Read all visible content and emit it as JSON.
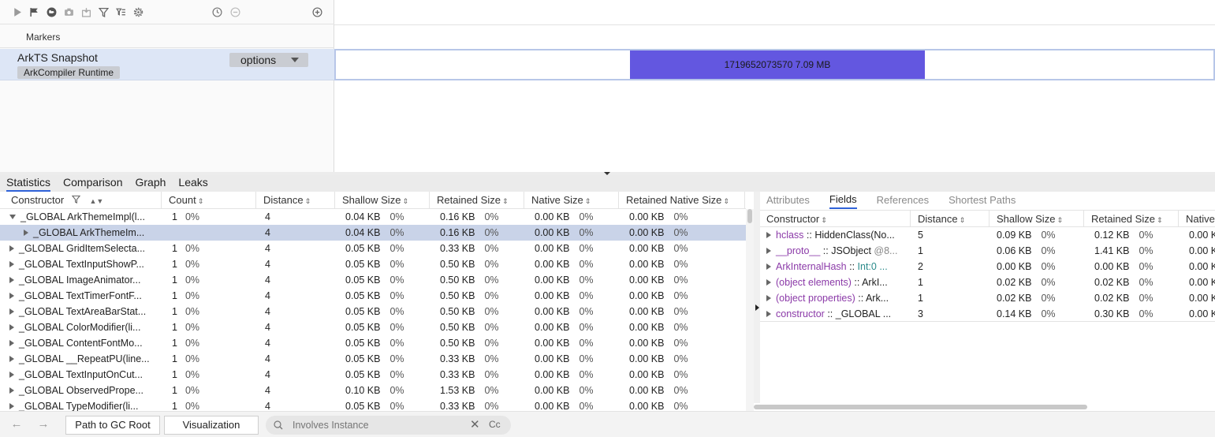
{
  "toolbar": {
    "icons": [
      "play-icon",
      "flag-icon",
      "globe-icon",
      "camera-icon",
      "dump-icon",
      "filter-icon",
      "filter-flow-icon",
      "gear-icon"
    ],
    "right_icons": [
      "clock-icon",
      "minus-circle-icon",
      "plus-circle-icon"
    ]
  },
  "timeline": {
    "markers_label": "Markers",
    "snapshot_title": "ArkTS Snapshot",
    "snapshot_subtitle": "ArkCompiler Runtime",
    "options_label": "options",
    "bar_label": "1719652073570 7.09 MB",
    "bar_color": "#6357e0"
  },
  "tabs": [
    {
      "label": "Statistics",
      "active": true
    },
    {
      "label": "Comparison",
      "active": false
    },
    {
      "label": "Graph",
      "active": false
    },
    {
      "label": "Leaks",
      "active": false
    }
  ],
  "left_table": {
    "columns": [
      "Constructor",
      "Count",
      "Distance",
      "Shallow Size",
      "Retained Size",
      "Native Size",
      "Retained Native Size"
    ],
    "rows": [
      {
        "name": "_GLOBAL ArkThemeImpl(l...",
        "count": "1",
        "count_pct": "0%",
        "distance": "4",
        "shallow": "0.04 KB",
        "shallow_pct": "0%",
        "retained": "0.16 KB",
        "retained_pct": "0%",
        "native": "0.00 KB",
        "native_pct": "0%",
        "rnative": "0.00 KB",
        "rnative_pct": "0%"
      },
      {
        "name": "_GLOBAL ArkThemeIm...",
        "count": "",
        "count_pct": "",
        "distance": "4",
        "shallow": "0.04 KB",
        "shallow_pct": "0%",
        "retained": "0.16 KB",
        "retained_pct": "0%",
        "native": "0.00 KB",
        "native_pct": "0%",
        "rnative": "0.00 KB",
        "rnative_pct": "0%"
      },
      {
        "name": "_GLOBAL GridItemSelecta...",
        "count": "1",
        "count_pct": "0%",
        "distance": "4",
        "shallow": "0.05 KB",
        "shallow_pct": "0%",
        "retained": "0.33 KB",
        "retained_pct": "0%",
        "native": "0.00 KB",
        "native_pct": "0%",
        "rnative": "0.00 KB",
        "rnative_pct": "0%"
      },
      {
        "name": "_GLOBAL TextInputShowP...",
        "count": "1",
        "count_pct": "0%",
        "distance": "4",
        "shallow": "0.05 KB",
        "shallow_pct": "0%",
        "retained": "0.50 KB",
        "retained_pct": "0%",
        "native": "0.00 KB",
        "native_pct": "0%",
        "rnative": "0.00 KB",
        "rnative_pct": "0%"
      },
      {
        "name": "_GLOBAL ImageAnimator...",
        "count": "1",
        "count_pct": "0%",
        "distance": "4",
        "shallow": "0.05 KB",
        "shallow_pct": "0%",
        "retained": "0.50 KB",
        "retained_pct": "0%",
        "native": "0.00 KB",
        "native_pct": "0%",
        "rnative": "0.00 KB",
        "rnative_pct": "0%"
      },
      {
        "name": "_GLOBAL TextTimerFontF...",
        "count": "1",
        "count_pct": "0%",
        "distance": "4",
        "shallow": "0.05 KB",
        "shallow_pct": "0%",
        "retained": "0.50 KB",
        "retained_pct": "0%",
        "native": "0.00 KB",
        "native_pct": "0%",
        "rnative": "0.00 KB",
        "rnative_pct": "0%"
      },
      {
        "name": "_GLOBAL TextAreaBarStat...",
        "count": "1",
        "count_pct": "0%",
        "distance": "4",
        "shallow": "0.05 KB",
        "shallow_pct": "0%",
        "retained": "0.50 KB",
        "retained_pct": "0%",
        "native": "0.00 KB",
        "native_pct": "0%",
        "rnative": "0.00 KB",
        "rnative_pct": "0%"
      },
      {
        "name": "_GLOBAL ColorModifier(li...",
        "count": "1",
        "count_pct": "0%",
        "distance": "4",
        "shallow": "0.05 KB",
        "shallow_pct": "0%",
        "retained": "0.50 KB",
        "retained_pct": "0%",
        "native": "0.00 KB",
        "native_pct": "0%",
        "rnative": "0.00 KB",
        "rnative_pct": "0%"
      },
      {
        "name": "_GLOBAL ContentFontMo...",
        "count": "1",
        "count_pct": "0%",
        "distance": "4",
        "shallow": "0.05 KB",
        "shallow_pct": "0%",
        "retained": "0.50 KB",
        "retained_pct": "0%",
        "native": "0.00 KB",
        "native_pct": "0%",
        "rnative": "0.00 KB",
        "rnative_pct": "0%"
      },
      {
        "name": "_GLOBAL __RepeatPU(line...",
        "count": "1",
        "count_pct": "0%",
        "distance": "4",
        "shallow": "0.05 KB",
        "shallow_pct": "0%",
        "retained": "0.33 KB",
        "retained_pct": "0%",
        "native": "0.00 KB",
        "native_pct": "0%",
        "rnative": "0.00 KB",
        "rnative_pct": "0%"
      },
      {
        "name": "_GLOBAL TextInputOnCut...",
        "count": "1",
        "count_pct": "0%",
        "distance": "4",
        "shallow": "0.05 KB",
        "shallow_pct": "0%",
        "retained": "0.33 KB",
        "retained_pct": "0%",
        "native": "0.00 KB",
        "native_pct": "0%",
        "rnative": "0.00 KB",
        "rnative_pct": "0%"
      },
      {
        "name": "_GLOBAL ObservedPrope...",
        "count": "1",
        "count_pct": "0%",
        "distance": "4",
        "shallow": "0.10 KB",
        "shallow_pct": "0%",
        "retained": "1.53 KB",
        "retained_pct": "0%",
        "native": "0.00 KB",
        "native_pct": "0%",
        "rnative": "0.00 KB",
        "rnative_pct": "0%"
      },
      {
        "name": "_GLOBAL TypeModifier(li...",
        "count": "1",
        "count_pct": "0%",
        "distance": "4",
        "shallow": "0.05 KB",
        "shallow_pct": "0%",
        "retained": "0.33 KB",
        "retained_pct": "0%",
        "native": "0.00 KB",
        "native_pct": "0%",
        "rnative": "0.00 KB",
        "rnative_pct": "0%"
      }
    ]
  },
  "right_panel": {
    "tabs": [
      {
        "label": "Attributes",
        "active": false
      },
      {
        "label": "Fields",
        "active": true
      },
      {
        "label": "References",
        "active": false
      },
      {
        "label": "Shortest Paths",
        "active": false
      }
    ],
    "columns": [
      "Constructor",
      "Distance",
      "Shallow Size",
      "Retained Size",
      "Native"
    ],
    "rows": [
      {
        "field": "hclass",
        "sep": " :: ",
        "value": "HiddenClass(No...",
        "extra": "",
        "distance": "5",
        "shallow": "0.09 KB",
        "shallow_pct": "0%",
        "retained": "0.12 KB",
        "retained_pct": "0%",
        "native": "0.00 K"
      },
      {
        "field": "__proto__",
        "sep": " :: ",
        "value": "JSObject ",
        "extra": "@8...",
        "distance": "1",
        "shallow": "0.06 KB",
        "shallow_pct": "0%",
        "retained": "1.41 KB",
        "retained_pct": "0%",
        "native": "0.00 K"
      },
      {
        "field": "ArkInternalHash",
        "sep": " :: ",
        "value": "",
        "extra": "Int:0 ...",
        "distance": "2",
        "shallow": "0.00 KB",
        "shallow_pct": "0%",
        "retained": "0.00 KB",
        "retained_pct": "0%",
        "native": "0.00 K"
      },
      {
        "field": "(object elements)",
        "sep": " :: ",
        "value": "ArkI...",
        "extra": "",
        "distance": "1",
        "shallow": "0.02 KB",
        "shallow_pct": "0%",
        "retained": "0.02 KB",
        "retained_pct": "0%",
        "native": "0.00 K"
      },
      {
        "field": "(object properties)",
        "sep": " :: ",
        "value": "Ark...",
        "extra": "",
        "distance": "1",
        "shallow": "0.02 KB",
        "shallow_pct": "0%",
        "retained": "0.02 KB",
        "retained_pct": "0%",
        "native": "0.00 K"
      },
      {
        "field": "constructor",
        "sep": " :: ",
        "value": "_GLOBAL ...",
        "extra": "",
        "distance": "3",
        "shallow": "0.14 KB",
        "shallow_pct": "0%",
        "retained": "0.30 KB",
        "retained_pct": "0%",
        "native": "0.00 K"
      }
    ]
  },
  "bottom": {
    "back_icon": "arrow-left-icon",
    "forward_icon": "arrow-right-icon",
    "path_button": "Path to GC Root",
    "visualization_button": "Visualization",
    "search_placeholder": "Involves Instance",
    "clear_label": "✕",
    "case_label": "Cc"
  }
}
